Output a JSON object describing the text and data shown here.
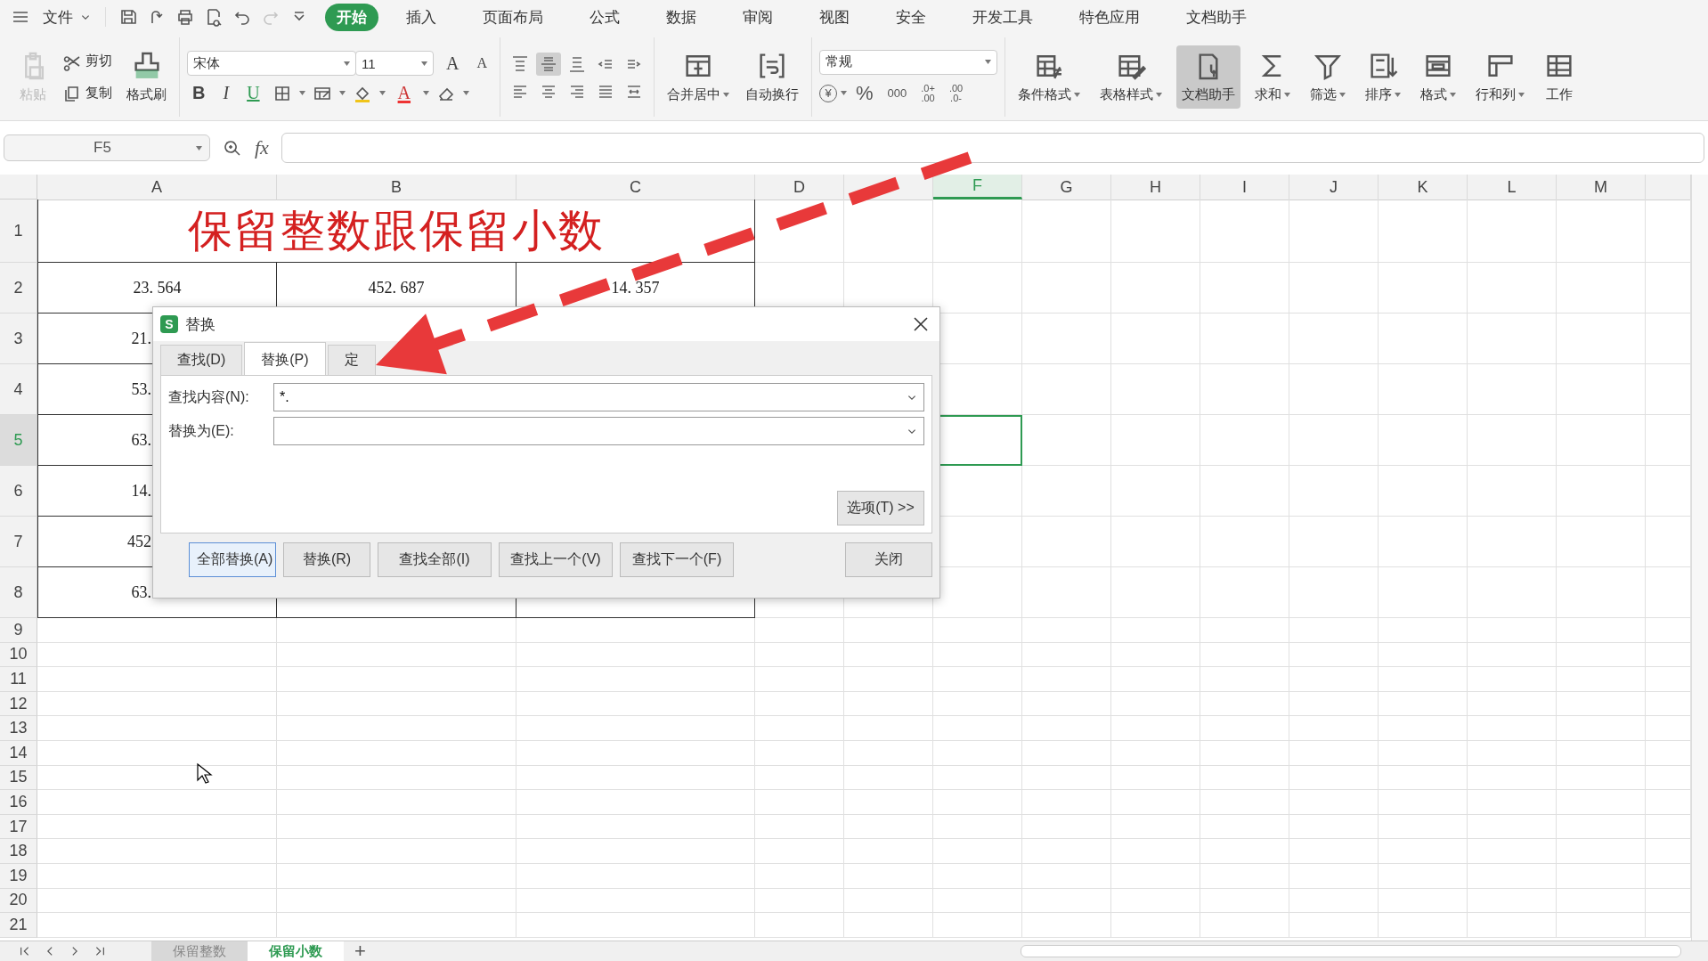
{
  "menu_bar": {
    "file_label": "文件",
    "quick_access": [
      {
        "disabled": false
      },
      {
        "disabled": false
      },
      {
        "disabled": false
      },
      {
        "disabled": false
      },
      {
        "disabled": false
      },
      {
        "disabled": true
      },
      {
        "disabled": false
      }
    ],
    "tabs": [
      {
        "label": "开始",
        "selected": true
      },
      {
        "label": "插入",
        "selected": false
      },
      {
        "label": "页面布局",
        "selected": false
      },
      {
        "label": "公式",
        "selected": false
      },
      {
        "label": "数据",
        "selected": false
      },
      {
        "label": "审阅",
        "selected": false
      },
      {
        "label": "视图",
        "selected": false
      },
      {
        "label": "安全",
        "selected": false
      },
      {
        "label": "开发工具",
        "selected": false
      },
      {
        "label": "特色应用",
        "selected": false
      },
      {
        "label": "文档助手",
        "selected": false
      }
    ]
  },
  "ribbon": {
    "clipboard": [
      {
        "label": "粘贴",
        "disabled": true
      },
      {
        "label": "剪切",
        "disabled": false
      },
      {
        "label": "复制",
        "disabled": false
      },
      {
        "label": "格式刷",
        "disabled": false
      }
    ],
    "font": {
      "name": "宋体",
      "size": "11",
      "grow": "A",
      "shrink": "A",
      "style_buttons": [
        "B",
        "I",
        "U"
      ],
      "font_color": "A"
    },
    "align_buttons": [
      {
        "selected": false
      },
      {
        "selected": true
      },
      {
        "selected": false
      },
      {
        "selected": false
      },
      {
        "selected": false
      },
      {
        "selected": false
      },
      {
        "selected": false
      },
      {
        "selected": false
      },
      {
        "selected": false
      },
      {
        "selected": false
      }
    ],
    "merge_buttons": [
      {
        "label": "合并居中",
        "dropdown": true
      },
      {
        "label": "自动换行",
        "dropdown": false
      }
    ],
    "number": {
      "format": "常规",
      "currency": "¥",
      "percent": "%",
      "thousands": "000",
      "increase_decimal": [
        ".0+",
        ".00"
      ],
      "decrease_decimal": [
        ".00",
        ".0-"
      ]
    },
    "tool_buttons": [
      {
        "label": "条件格式",
        "dropdown": true,
        "selected": false
      },
      {
        "label": "表格样式",
        "dropdown": true,
        "selected": false
      },
      {
        "label": "文档助手",
        "dropdown": false,
        "selected": true
      },
      {
        "label": "求和",
        "dropdown": true,
        "selected": false
      },
      {
        "label": "筛选",
        "dropdown": true,
        "selected": false
      },
      {
        "label": "排序",
        "dropdown": true,
        "selected": false
      },
      {
        "label": "格式",
        "dropdown": true,
        "selected": false
      },
      {
        "label": "行和列",
        "dropdown": true,
        "selected": false
      },
      {
        "label": "工作",
        "dropdown": false,
        "selected": false
      }
    ]
  },
  "formula_bar": {
    "name_box": "F5",
    "function_label": "fx"
  },
  "sheet": {
    "columns": [
      {
        "label": "A",
        "selected": false
      },
      {
        "label": "B",
        "selected": false
      },
      {
        "label": "C",
        "selected": false
      },
      {
        "label": "D",
        "selected": false
      },
      {
        "selected": false
      },
      {
        "label": "F",
        "selected": true
      },
      {
        "label": "G",
        "selected": false
      },
      {
        "label": "H",
        "selected": false
      },
      {
        "label": "I",
        "selected": false
      },
      {
        "label": "J",
        "selected": false
      },
      {
        "label": "K",
        "selected": false
      },
      {
        "label": "L",
        "selected": false
      },
      {
        "label": "M",
        "selected": false
      },
      {
        "selected": false
      }
    ],
    "rows": [
      {
        "number": "1",
        "selected": false,
        "kind": "title",
        "title": "保留整数跟保留小数"
      },
      {
        "number": "2",
        "selected": false,
        "kind": "data",
        "cells": [
          "23. 564",
          "452. 687",
          "14. 357"
        ]
      },
      {
        "number": "3",
        "selected": false,
        "kind": "covered",
        "cells": [
          "21."
        ]
      },
      {
        "number": "4",
        "selected": false,
        "kind": "covered",
        "cells": [
          "53."
        ]
      },
      {
        "number": "5",
        "selected": true,
        "kind": "covered",
        "cells": [
          "63."
        ]
      },
      {
        "number": "6",
        "selected": false,
        "kind": "covered",
        "cells": [
          "14."
        ]
      },
      {
        "number": "7",
        "selected": false,
        "kind": "covered",
        "cells": [
          "452"
        ]
      },
      {
        "number": "8",
        "selected": false,
        "kind": "covered",
        "cells": [
          "63."
        ]
      },
      {
        "number": "9",
        "selected": false,
        "kind": "blank"
      },
      {
        "number": "10",
        "selected": false,
        "kind": "blank"
      },
      {
        "number": "11",
        "selected": false,
        "kind": "blank"
      },
      {
        "number": "12",
        "selected": false,
        "kind": "blank"
      },
      {
        "number": "13",
        "selected": false,
        "kind": "blank"
      },
      {
        "number": "14",
        "selected": false,
        "kind": "blank"
      },
      {
        "number": "15",
        "selected": false,
        "kind": "blank"
      },
      {
        "number": "16",
        "selected": false,
        "kind": "blank"
      },
      {
        "number": "17",
        "selected": false,
        "kind": "blank"
      },
      {
        "number": "18",
        "selected": false,
        "kind": "blank"
      },
      {
        "number": "19",
        "selected": false,
        "kind": "blank"
      },
      {
        "number": "20",
        "selected": false,
        "kind": "blank"
      },
      {
        "number": "21",
        "selected": false,
        "kind": "blank"
      }
    ],
    "tabs": [
      {
        "label": "保留整数",
        "selected": false
      },
      {
        "label": "保留小数",
        "selected": true
      }
    ],
    "add_sheet": "+"
  },
  "dialog": {
    "title": "替换",
    "icon_text": "S",
    "tabs": [
      {
        "label": "查找(D)",
        "selected": false
      },
      {
        "label": "替换(P)",
        "selected": true
      },
      {
        "label": "定",
        "selected": false
      }
    ],
    "fields": [
      {
        "label": "查找内容(N):",
        "value": "*."
      },
      {
        "label": "替换为(E):"
      }
    ],
    "options_button": "选项(T) >>",
    "buttons": [
      {
        "label": "全部替换(A)",
        "focused": true
      },
      {
        "label": "替换(R)",
        "focused": false
      },
      {
        "label": "查找全部(I)",
        "focused": false
      },
      {
        "label": "查找上一个(V)",
        "focused": false
      },
      {
        "label": "查找下一个(F)",
        "focused": false
      },
      {
        "label": "关闭",
        "focused": false
      }
    ]
  }
}
